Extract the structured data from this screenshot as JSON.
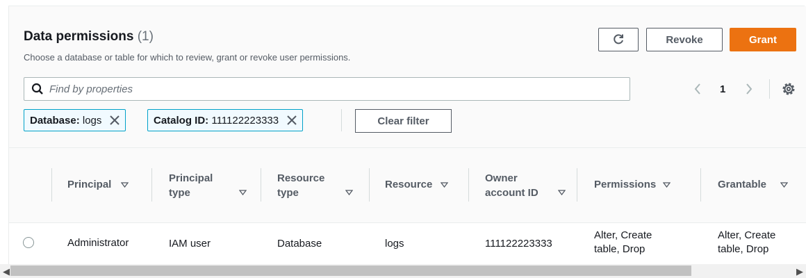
{
  "header": {
    "title": "Data permissions",
    "count": "(1)",
    "subtitle": "Choose a database or table for which to review, grant or revoke user permissions."
  },
  "actions": {
    "refresh_icon": "refresh-icon",
    "revoke_label": "Revoke",
    "grant_label": "Grant",
    "grant_color": "#ec7211"
  },
  "search": {
    "placeholder": "Find by properties",
    "value": ""
  },
  "pagination": {
    "current_page": "1"
  },
  "filters": [
    {
      "key": "Database:",
      "value": "logs"
    },
    {
      "key": "Catalog ID:",
      "value": "111122223333"
    }
  ],
  "clear_filter_label": "Clear filter",
  "table": {
    "columns": [
      {
        "l1": "Principal",
        "l2": ""
      },
      {
        "l1": "Principal",
        "l2": "type"
      },
      {
        "l1": "Resource",
        "l2": "type"
      },
      {
        "l1": "Resource",
        "l2": ""
      },
      {
        "l1": "Owner",
        "l2": "account ID"
      },
      {
        "l1": "Permissions",
        "l2": ""
      },
      {
        "l1": "Grantable",
        "l2": ""
      }
    ],
    "rows": [
      {
        "principal": "Administrator",
        "principal_type": "IAM user",
        "resource_type": "Database",
        "resource": "logs",
        "owner_account_id": "111122223333",
        "permissions_l1": "Alter, Create",
        "permissions_l2": "table, Drop",
        "grantable_l1": "Alter, Create",
        "grantable_l2": "table, Drop"
      }
    ]
  }
}
